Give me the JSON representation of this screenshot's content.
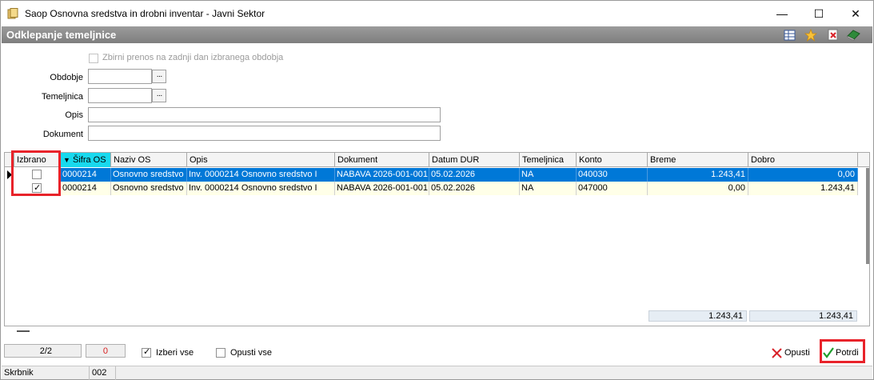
{
  "window": {
    "title": "Saop Osnovna sredstva in drobni inventar - Javni Sektor",
    "minimize_glyph": "—",
    "maximize_glyph": "☐",
    "close_glyph": "✕"
  },
  "header": {
    "title": "Odklepanje temeljnice",
    "icons": [
      "grid-settings-icon",
      "star-icon",
      "close-document-icon",
      "book-icon"
    ]
  },
  "form": {
    "checkbox_label": "Zbirni prenos na zadnji dan izbranega obdobja",
    "fields": {
      "obdobje": {
        "label": "Obdobje",
        "value": ""
      },
      "temeljnica": {
        "label": "Temeljnica",
        "value": ""
      },
      "opis": {
        "label": "Opis",
        "value": ""
      },
      "dokument": {
        "label": "Dokument",
        "value": ""
      }
    },
    "dots_glyph": "···"
  },
  "grid": {
    "columns": [
      "Izbrano",
      "Šifra OS",
      "Naziv OS",
      "Opis",
      "Dokument",
      "Datum DUR",
      "Temeljnica",
      "Konto",
      "Breme",
      "Dobro"
    ],
    "sort_glyph": "▼",
    "rows": [
      {
        "sifra": "0000214",
        "naziv": "Osnovno sredstvo I",
        "opis": "Inv. 0000214 Osnovno sredstvo I",
        "dokument": "NABAVA 2026-001-001",
        "datum": "05.02.2026",
        "temeljnica": "NA",
        "konto": "040030",
        "breme": "1.243,41",
        "dobro": "0,00"
      },
      {
        "sifra": "0000214",
        "naziv": "Osnovno sredstvo I",
        "opis": "Inv. 0000214 Osnovno sredstvo I",
        "dokument": "NABAVA 2026-001-001",
        "datum": "05.02.2026",
        "temeljnica": "NA",
        "konto": "047000",
        "breme": "0,00",
        "dobro": "1.243,41"
      }
    ],
    "totals": {
      "breme": "1.243,41",
      "dobro": "1.243,41"
    }
  },
  "toolbar": {
    "record_count": "2/2",
    "error_count": "0",
    "select_all": "Izberi vse",
    "deselect_all": "Opusti vse",
    "cancel": "Opusti",
    "confirm": "Potrdi"
  },
  "statusbar": {
    "user": "Skrbnik",
    "code": "002"
  },
  "colors": {
    "selected_row": "#0078d7",
    "normal_row": "#ffffe8",
    "sorted_header": "#18d9ee",
    "highlight_outline": "#e8232a"
  }
}
